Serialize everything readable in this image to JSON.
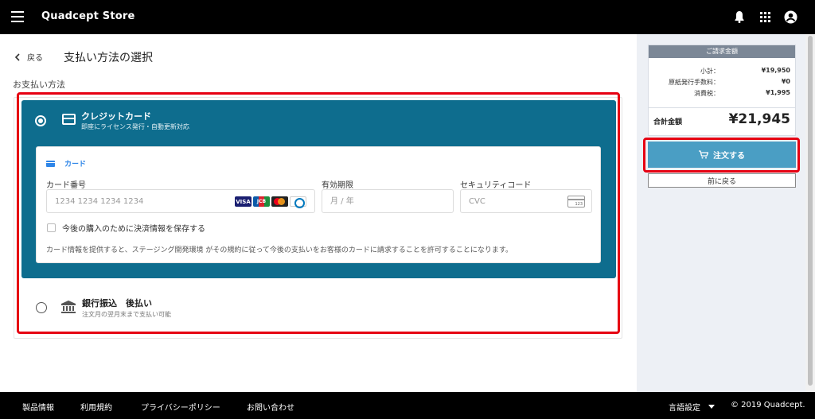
{
  "header": {
    "title": "Quadcept Store"
  },
  "nav": {
    "back_label": "戻る",
    "page_title": "支払い方法の選択"
  },
  "payment": {
    "section_label": "お支払い方法",
    "credit": {
      "title": "クレジットカード",
      "subtitle": "即座にライセンス発行・自動更新対応",
      "selected": true,
      "card_header": "カード",
      "card_number_label": "カード番号",
      "card_number_placeholder": "1234 1234 1234 1234",
      "brands": [
        "VISA",
        "JCB",
        "Mastercard",
        "Diners"
      ],
      "brand_visa": "VISA",
      "brand_jcb": "JCB",
      "expiry_label": "有効期限",
      "expiry_placeholder": "月 / 年",
      "cvc_label": "セキュリティコード",
      "cvc_placeholder": "CVC",
      "cvc_icon_text": "123",
      "save_label": "今後の購入のために決済情報を保存する",
      "terms": "カード情報を提供すると、ステージング開発環境 がその規約に従って今後の支払いをお客様のカードに請求することを許可することになります。"
    },
    "bank": {
      "title": "銀行振込　後払い",
      "subtitle": "注文月の翌月末まで支払い可能",
      "selected": false
    }
  },
  "summary": {
    "header": "ご請求金額",
    "rows": [
      {
        "label": "小計：",
        "value": "¥19,950"
      },
      {
        "label": "原紙発行手数料：",
        "value": "¥0"
      },
      {
        "label": "消費税：",
        "value": "¥1,995"
      }
    ],
    "total_label": "合計金額",
    "total_value": "¥21,945",
    "order_button": "注文する",
    "back_button": "前に戻る"
  },
  "footer": {
    "links": [
      "製品情報",
      "利用規約",
      "プライバシーポリシー",
      "お問い合わせ"
    ],
    "language": "言語設定",
    "copyright": "© 2019 Quadcept."
  },
  "colors": {
    "accent": "#0e6d8e",
    "order_button": "#4a9ec4",
    "highlight": "#e60012"
  }
}
